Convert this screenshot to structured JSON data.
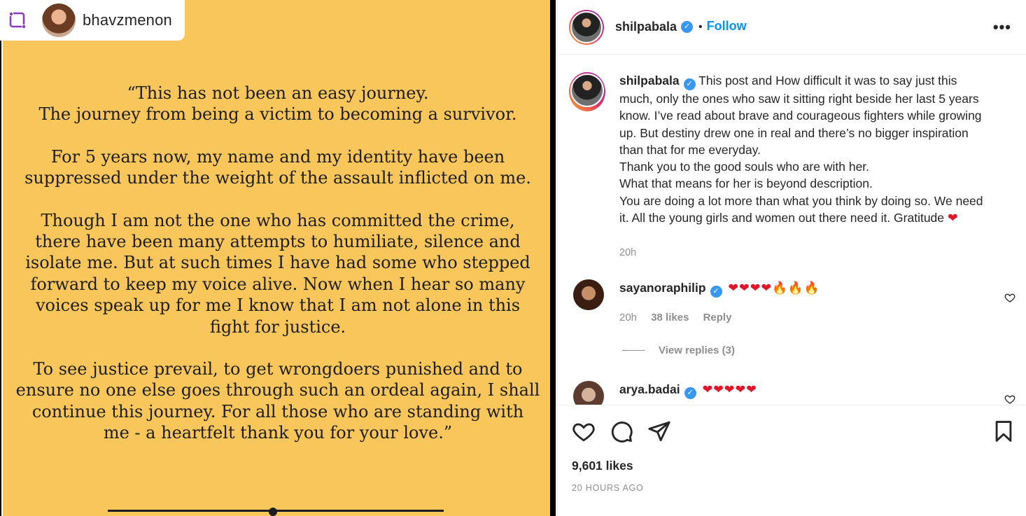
{
  "media": {
    "repost_user": "bhavzmenon",
    "quote_paragraphs": [
      [
        "“This has not been an easy journey.",
        "The journey from being a victim to becoming a survivor."
      ],
      [
        "For 5 years now, my name and my identity have been",
        "suppressed under the weight of the assault inflicted on me."
      ],
      [
        "Though I am not the one who has committed the crime,",
        "there have been many attempts to humiliate, silence and",
        "isolate me. But at such times I have had some who  stepped",
        "forward to keep my voice alive.  Now when I hear so many",
        "voices speak up for me I know that I am not alone in this",
        "fight for justice."
      ],
      [
        "To see justice prevail, to get wrongdoers punished and to",
        "ensure no one else goes through such an ordeal again, I shall",
        "continue this journey. For all those who are standing with",
        "me  - a heartfelt thank you for your love.”"
      ]
    ]
  },
  "header": {
    "username": "shilpabala",
    "separator": "•",
    "follow_label": "Follow",
    "more_label": "•••"
  },
  "caption": {
    "username": "shilpabala",
    "lines": [
      "This post and How difficult it was to say just this",
      "much, only the ones who saw it sitting right beside her last 5 years",
      "know. I’ve read about brave and courageous fighters while growing",
      "up. But destiny drew one in real and there’s no bigger inspiration",
      "than that for me everyday.",
      "Thank you to the good souls who are with her.",
      "What that means for her is beyond description.",
      "You are doing a lot more than what you think by doing so. We need",
      "it. All the young girls and women out there need it. Gratitude"
    ],
    "end_emoji": "❤",
    "time": "20h"
  },
  "comments": [
    {
      "username": "sayanoraphilip",
      "text": "❤❤❤❤🔥🔥🔥",
      "time": "20h",
      "likes": "38 likes",
      "reply_label": "Reply",
      "view_replies": "View replies (3)"
    },
    {
      "username": "arya.badai",
      "text": "❤❤❤❤❤"
    }
  ],
  "footer": {
    "likes": "9,601 likes",
    "posted": "20 HOURS AGO"
  },
  "icons": {
    "like": "heart-outline-icon",
    "comment": "comment-bubble-icon",
    "share": "paper-plane-icon",
    "save": "bookmark-icon",
    "verified": "verified-badge-icon",
    "repost": "repost-icon"
  },
  "colors": {
    "poster_bg": "#f8c65a",
    "follow_blue": "#0095f6",
    "verified_blue": "#3897f0",
    "heart_red": "#e0172b",
    "muted_gray": "#8e8e8e"
  }
}
